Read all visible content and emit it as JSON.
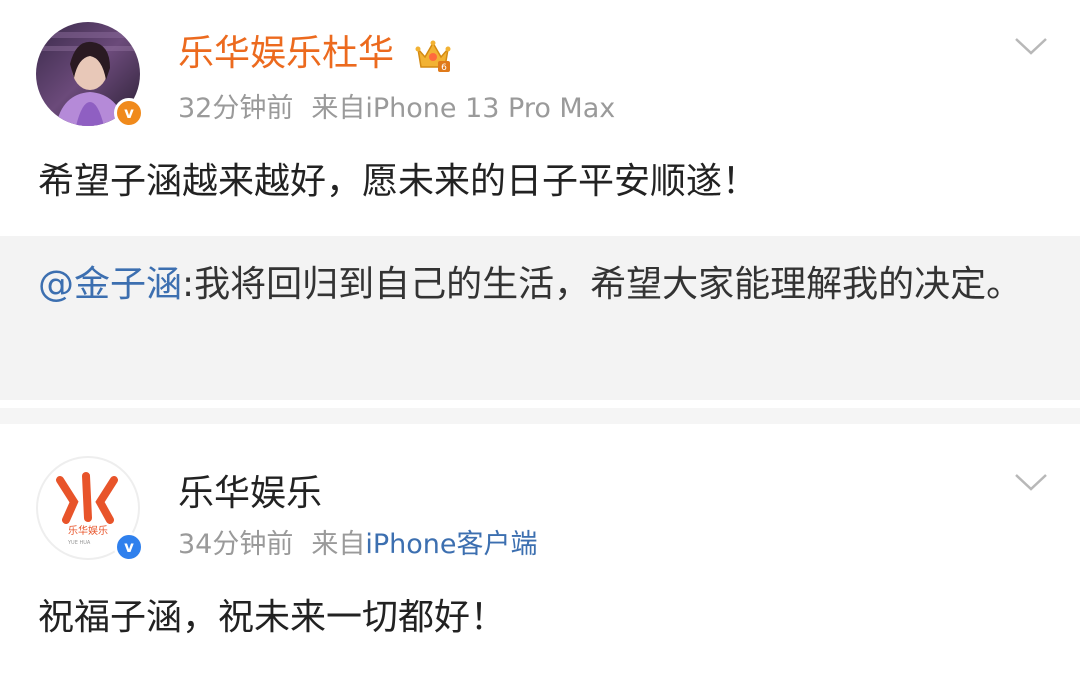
{
  "posts": [
    {
      "username": "乐华娱乐杜华",
      "time": "32分钟前",
      "source_prefix": "来自",
      "device": "iPhone 13 Pro Max",
      "verified_letter": "v",
      "vip_level": "6",
      "text": "希望子涵越来越好，愿未来的日子平安顺遂！",
      "repost": {
        "mention": "@金子涵",
        "text": ":我将回归到自己的生活，希望大家能理解我的决定。"
      }
    },
    {
      "username": "乐华娱乐",
      "time": "34分钟前",
      "source_prefix": "来自",
      "device": "iPhone客户端",
      "verified_letter": "v",
      "logo_text": "乐华娱乐",
      "logo_sub": "YUE HUA",
      "text": "祝福子涵，祝未来一切都好！"
    }
  ],
  "colors": {
    "vip_name": "#ec6a1e",
    "meta": "#9a9a9a",
    "link": "#3c6fb0",
    "repost_bg": "#f3f3f3",
    "verified_orange": "#f08a1c",
    "verified_blue": "#2f80ed"
  },
  "icons": {
    "crown": "vip-crown-icon",
    "chevron": "chevron-down-icon",
    "verified": "verified-badge-icon"
  }
}
